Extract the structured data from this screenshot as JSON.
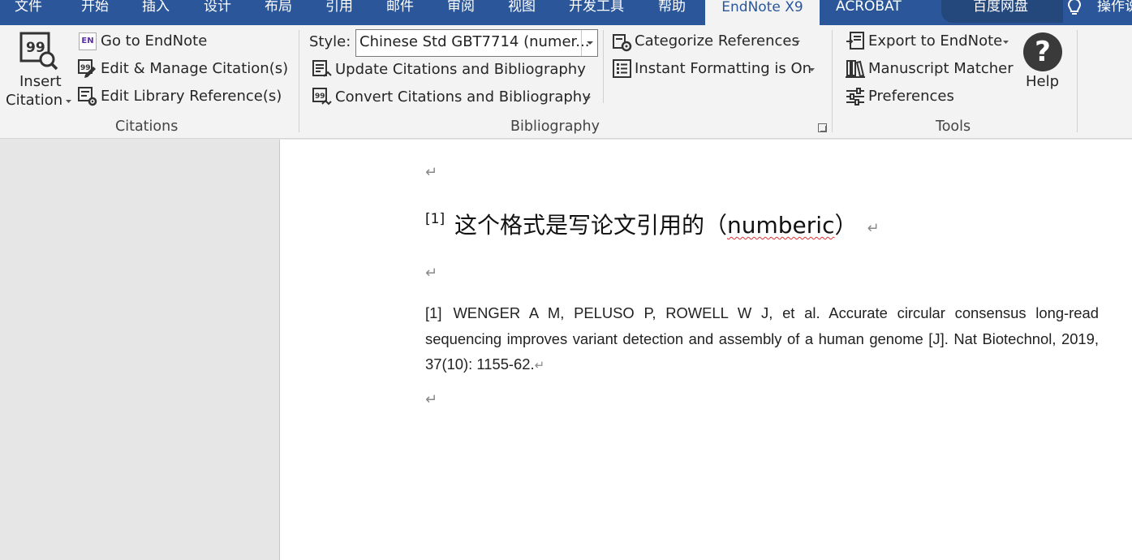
{
  "tabs": [
    {
      "label": "文件"
    },
    {
      "label": "开始"
    },
    {
      "label": "插入"
    },
    {
      "label": "设计"
    },
    {
      "label": "布局"
    },
    {
      "label": "引用"
    },
    {
      "label": "邮件"
    },
    {
      "label": "审阅"
    },
    {
      "label": "视图"
    },
    {
      "label": "开发工具"
    },
    {
      "label": "帮助"
    },
    {
      "label": "EndNote X9"
    },
    {
      "label": "ACROBAT"
    },
    {
      "label": "百度网盘"
    },
    {
      "label": "操作说明"
    }
  ],
  "active_tab": "EndNote X9",
  "ribbon": {
    "citations": {
      "insert_label_1": "Insert",
      "insert_label_2": "Citation",
      "go_to_endnote": "Go to EndNote",
      "edit_manage": "Edit & Manage Citation(s)",
      "edit_library": "Edit Library Reference(s)",
      "group_label": "Citations",
      "en_badge": "EN"
    },
    "bibliography": {
      "style_label": "Style:",
      "style_value": "Chinese Std GBT7714 (numer...",
      "update": "Update Citations and Bibliography",
      "convert": "Convert Citations and Bibliography",
      "categorize": "Categorize References",
      "instant_formatting": "Instant Formatting is On",
      "group_label": "Bibliography"
    },
    "tools": {
      "export": "Export to EndNote",
      "manuscript_matcher": "Manuscript Matcher",
      "preferences": "Preferences",
      "help": "Help",
      "group_label": "Tools"
    }
  },
  "document": {
    "para_mark": "↵",
    "heading_sup": "[1]",
    "heading_text_1": "这个格式是写论文引用的（",
    "heading_text_2": "numberic",
    "heading_text_3": "）",
    "reference_num": "[1]",
    "reference_text": "WENGER A M, PELUSO P, ROWELL W J, et al. Accurate circular consensus long-read sequencing improves variant detection and assembly of a human genome [J]. Nat Biotechnol, 2019, 37(10): 1155-62."
  },
  "colors": {
    "tabbar": "#2b579a",
    "ribbon": "#f3f3f3",
    "page": "#ffffff",
    "leftpane": "#e6e6e6"
  }
}
